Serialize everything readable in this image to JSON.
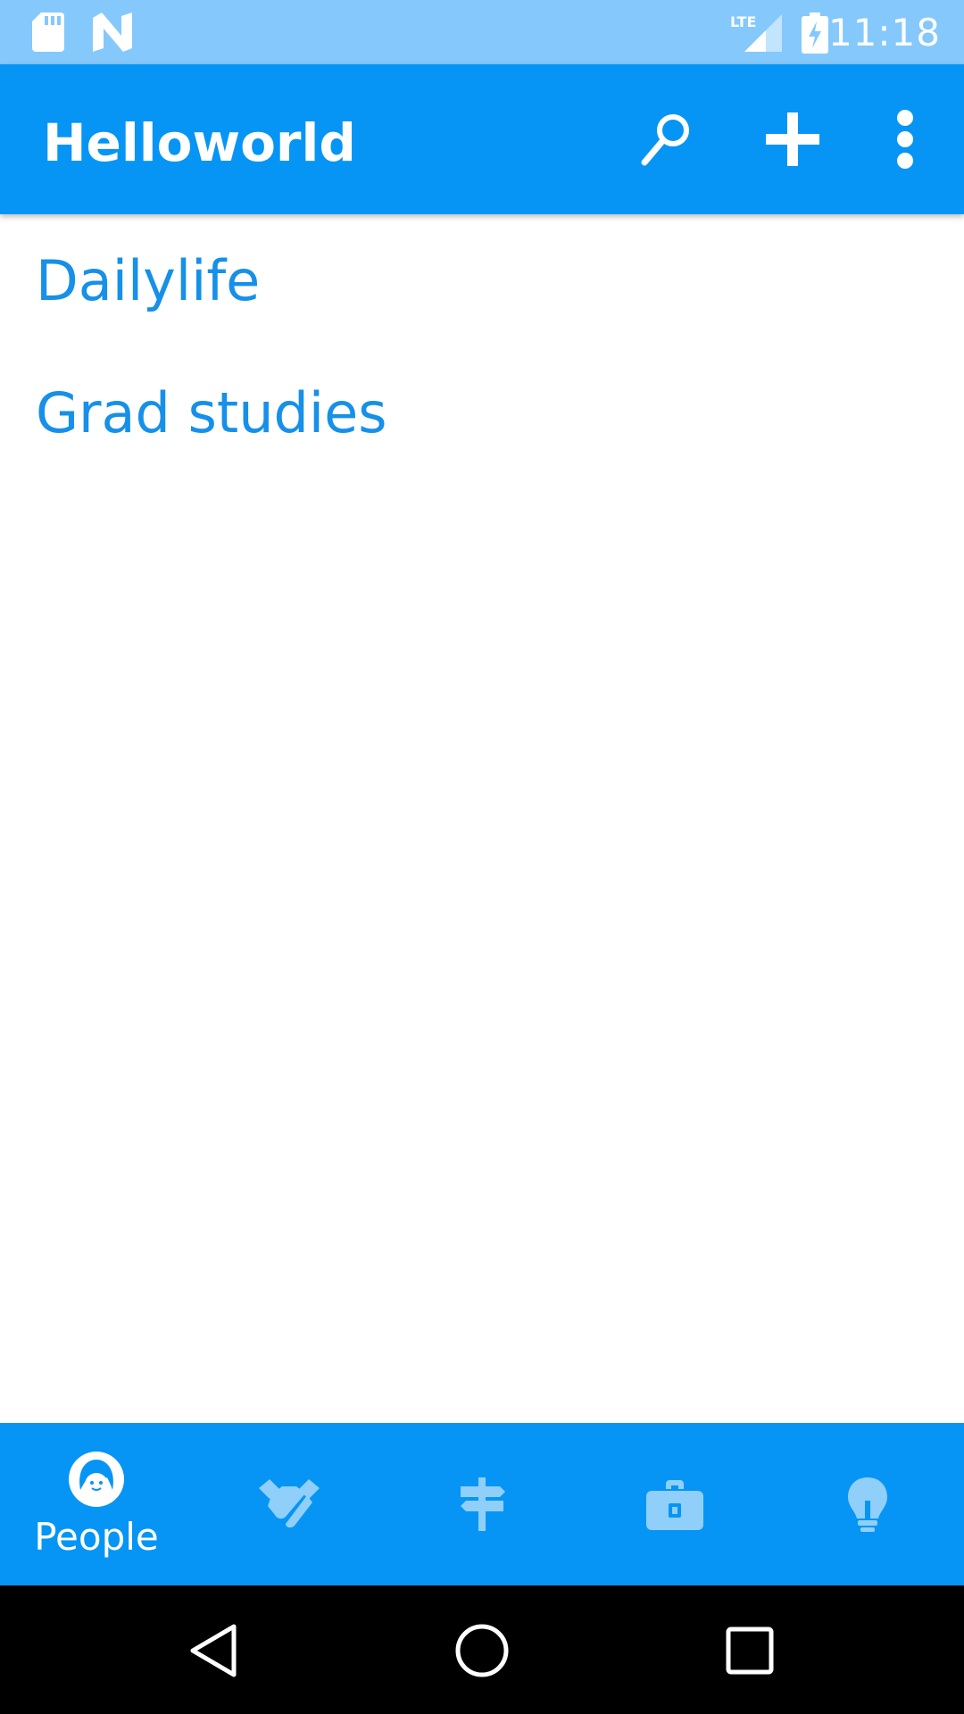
{
  "status_bar": {
    "time": "11:18",
    "network": "LTE",
    "icons": [
      "sd-card-icon",
      "notification-n-icon",
      "lte-signal-icon",
      "battery-charging-icon"
    ]
  },
  "app_bar": {
    "title": "Helloworld",
    "actions": [
      "search-icon",
      "add-icon",
      "more-vert-icon"
    ]
  },
  "list": {
    "items": [
      {
        "label": "Dailylife"
      },
      {
        "label": "Grad studies"
      }
    ]
  },
  "bottom_nav": {
    "tabs": [
      {
        "label": "People",
        "icon": "person-icon",
        "selected": true
      },
      {
        "icon": "handshake-icon",
        "selected": false
      },
      {
        "icon": "signpost-icon",
        "selected": false
      },
      {
        "icon": "briefcase-icon",
        "selected": false
      },
      {
        "icon": "lightbulb-icon",
        "selected": false
      }
    ]
  },
  "system_nav": {
    "buttons": [
      "back-icon",
      "home-icon",
      "recents-icon"
    ]
  },
  "colors": {
    "primary": "#0695f4",
    "status_bar": "#85c8fb",
    "list_text": "#1690e8",
    "inactive_icon": "#6fc0f7"
  }
}
